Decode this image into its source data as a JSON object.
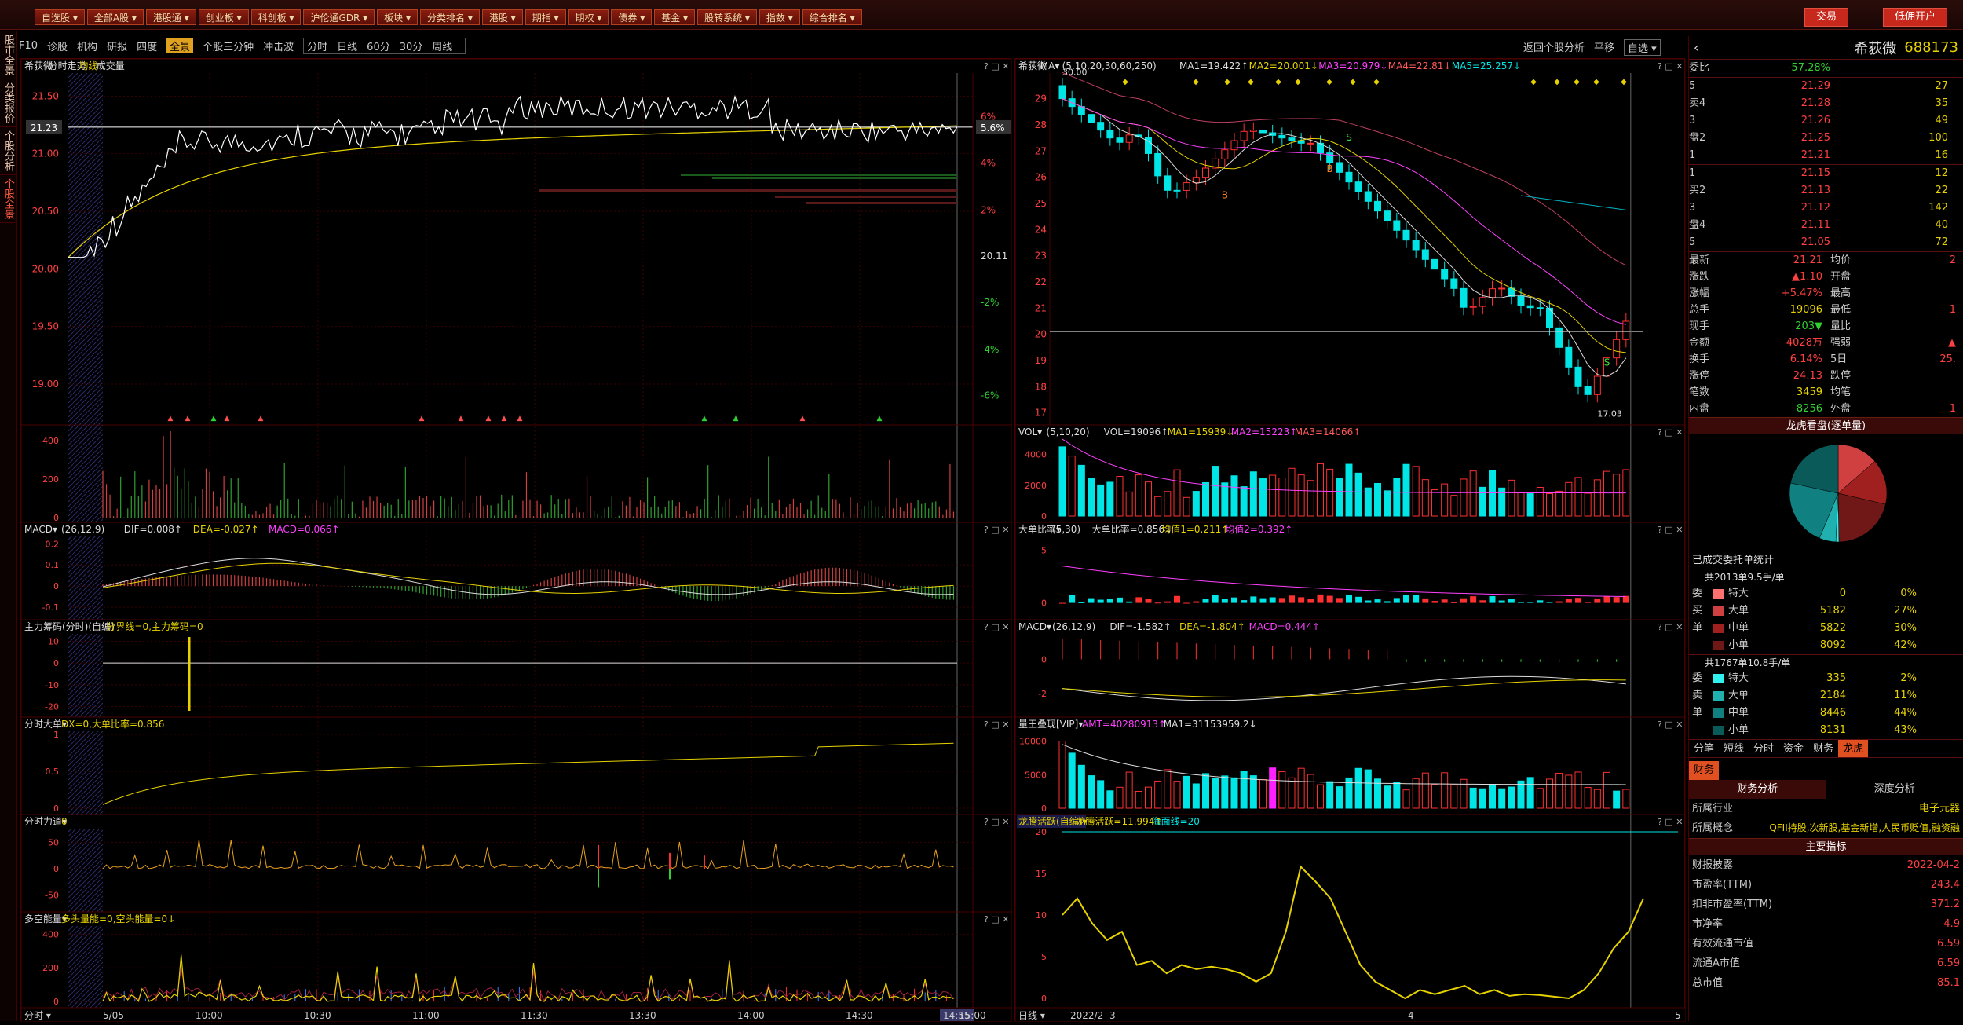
{
  "nav": {
    "items": [
      "自选股",
      "全部A股",
      "港股通",
      "创业板",
      "科创板",
      "沪伦通GDR",
      "板块",
      "分类排名",
      "港股",
      "期指",
      "期权",
      "债券",
      "基金",
      "股转系统",
      "指数",
      "综合排名"
    ],
    "right_buttons": [
      "交易",
      "低佣开户"
    ]
  },
  "left_rail": [
    "股市全景",
    "分类报价",
    "个股分析",
    "个股全景"
  ],
  "toolbar": {
    "items": [
      "F10",
      "诊股",
      "机构",
      "研报",
      "四度",
      "全景",
      "个股三分钟",
      "冲击波"
    ],
    "active": "全景",
    "period_tabs": [
      "分时",
      "日线",
      "60分",
      "30分",
      "周线"
    ],
    "right_items": [
      "返回个股分析",
      "平移",
      "自选"
    ]
  },
  "left_panels": {
    "main_title": {
      "name": "希荻微",
      "mode": "分时走势",
      "avg": "均线",
      "vol": "成交量"
    },
    "price_levels": [
      "21.50",
      "21.00",
      "20.50",
      "20.00",
      "19.50",
      "19.00"
    ],
    "current_price": "21.23",
    "pct_levels": [
      "6%",
      "4%",
      "2%",
      "20.11",
      "-2%",
      "-4%",
      "-6%"
    ],
    "current_pct": "5.6%",
    "vol_axis": [
      "400",
      "200",
      "0"
    ],
    "macd": {
      "label": "MACD",
      "params": "(26,12,9)",
      "dif": "DIF=0.008↑",
      "dea": "DEA=-0.027↑",
      "macd": "MACD=0.066↑",
      "axis": [
        "0.2",
        "0.1",
        "0",
        "-0.1"
      ]
    },
    "chip": {
      "label": "主力筹码(分时)(自编)",
      "text": "分界线=0,主力筹码=0",
      "axis": [
        "10",
        "0",
        "-10",
        "-20"
      ]
    },
    "big": {
      "label": "分时大单",
      "text": "DX=0,大单比率=0.856",
      "axis": [
        "1",
        "0.5",
        "0"
      ]
    },
    "force": {
      "label": "分时力道",
      "text": "0",
      "axis": [
        "50",
        "0",
        "-50"
      ]
    },
    "energy": {
      "label": "多空能量",
      "text": "多头量能=0,空头能量=0↓",
      "axis": [
        "400",
        "200",
        "0"
      ]
    },
    "time_axis": [
      "分时",
      "5/05",
      "10:00",
      "10:30",
      "11:00",
      "11:30",
      "13:30",
      "14:00",
      "14:30",
      "14:55",
      "15:00"
    ]
  },
  "mid_panels": {
    "kline": {
      "name": "希荻微",
      "ma": "MA",
      "params": "(5,10,20,30,60,250)",
      "ma1": "MA1=19.422↑",
      "ma2": "MA2=20.001↓",
      "ma3": "MA3=20.979↓",
      "ma4": "MA4=22.81↓",
      "ma5": "MA5=25.257↓",
      "axis": [
        "29",
        "28",
        "27",
        "26",
        "25",
        "24",
        "23",
        "22",
        "21",
        "20",
        "19",
        "18",
        "17"
      ],
      "high": "30.00",
      "low": "17.03",
      "signals": [
        "B",
        "B",
        "S",
        "S"
      ]
    },
    "vol": {
      "label": "VOL",
      "params": "(5,10,20)",
      "v": "VOL=19096↑",
      "ma1": "MA1=15939↓",
      "ma2": "MA2=15223↑",
      "ma3": "MA3=14066↑",
      "axis": [
        "4000",
        "2000",
        "0"
      ]
    },
    "big": {
      "label": "大单比率",
      "params": "(5,30)",
      "v": "大单比率=0.856↓",
      "a1": "均值1=0.211↑",
      "a2": "均值2=0.392↑",
      "axis": [
        "5",
        "0"
      ]
    },
    "macd": {
      "label": "MACD",
      "params": "(26,12,9)",
      "dif": "DIF=-1.582↑",
      "dea": "DEA=-1.804↑",
      "macd": "MACD=0.444↑",
      "axis": [
        "0",
        "-2"
      ]
    },
    "energy": {
      "label": "量王叠现[VIP]",
      "amt": "AMT=40280913↑",
      "ma1": "MA1=31153959.2↓",
      "axis": [
        "10000",
        "5000",
        "0"
      ]
    },
    "dragon": {
      "label": "龙腾活跃(自编)",
      "v": "龙腾活跃=11.994↑",
      "sea": "海面线=20",
      "axis": [
        "20",
        "15",
        "10",
        "5",
        "0"
      ]
    },
    "date_axis": [
      "日线",
      "2022/2",
      "3",
      "4",
      "5"
    ]
  },
  "quote": {
    "name": "希荻微",
    "code": "688173",
    "ratio_label": "委比",
    "ratio": "-57.28%",
    "asks": [
      {
        "k": "5",
        "p": "21.29",
        "v": "27"
      },
      {
        "k": "卖4",
        "p": "21.28",
        "v": "35"
      },
      {
        "k": "3",
        "p": "21.26",
        "v": "49"
      },
      {
        "k": "盘2",
        "p": "21.25",
        "v": "100"
      },
      {
        "k": "1",
        "p": "21.21",
        "v": "16"
      }
    ],
    "bids": [
      {
        "k": "1",
        "p": "21.15",
        "v": "12"
      },
      {
        "k": "买2",
        "p": "21.13",
        "v": "22"
      },
      {
        "k": "3",
        "p": "21.12",
        "v": "142"
      },
      {
        "k": "盘4",
        "p": "21.11",
        "v": "40"
      },
      {
        "k": "5",
        "p": "21.05",
        "v": "72"
      }
    ],
    "stats": [
      [
        "最新",
        "21.21",
        "均价",
        "2"
      ],
      [
        "涨跌",
        "▲1.10",
        "开盘",
        ""
      ],
      [
        "涨幅",
        "+5.47%",
        "最高",
        ""
      ],
      [
        "总手",
        "19096",
        "最低",
        "1"
      ],
      [
        "现手",
        "203▼",
        "量比",
        ""
      ],
      [
        "金额",
        "4028万",
        "强弱",
        "▲"
      ],
      [
        "换手",
        "6.14%",
        "5日",
        "25."
      ],
      [
        "涨停",
        "24.13",
        "跌停",
        ""
      ],
      [
        "笔数",
        "3459",
        "均笔",
        ""
      ],
      [
        "内盘",
        "8256",
        "外盘",
        "1"
      ]
    ]
  },
  "dragon_section": {
    "title": "龙虎看盘(逐单量)",
    "sub": "已成交委托单统计",
    "buy_total": "共2013单9.5手/单",
    "buy": [
      {
        "s": "委",
        "n": "特大",
        "q": "0",
        "pc": "0%",
        "c": "#ff7070"
      },
      {
        "s": "买",
        "n": "大单",
        "q": "5182",
        "pc": "27%",
        "c": "#d04040"
      },
      {
        "s": "单",
        "n": "中单",
        "q": "5822",
        "pc": "30%",
        "c": "#a02020"
      },
      {
        "s": "",
        "n": "小单",
        "q": "8092",
        "pc": "42%",
        "c": "#701818"
      }
    ],
    "sell_total": "共1767单10.8手/单",
    "sell": [
      {
        "s": "委",
        "n": "特大",
        "q": "335",
        "pc": "2%",
        "c": "#30f0f0"
      },
      {
        "s": "卖",
        "n": "大单",
        "q": "2184",
        "pc": "11%",
        "c": "#20b0b0"
      },
      {
        "s": "单",
        "n": "中单",
        "q": "8446",
        "pc": "44%",
        "c": "#108080"
      },
      {
        "s": "",
        "n": "小单",
        "q": "8131",
        "pc": "43%",
        "c": "#0a5a5a"
      }
    ],
    "tabs": [
      "分笔",
      "短线",
      "分时",
      "资金",
      "财务",
      "龙虎"
    ],
    "active_tab": "龙虎"
  },
  "finance": {
    "tab": "财务",
    "sub_tabs": [
      "财务分析",
      "深度分析"
    ],
    "industry_label": "所属行业",
    "industry": "电子元器",
    "concept_label": "所属概念",
    "concept": "QFII持股,次新股,基金新增,人民币贬值,融资融",
    "key_title": "主要指标",
    "rows": [
      [
        "财报披露",
        "2022-04-2"
      ],
      [
        "市盈率(TTM)",
        "243.4"
      ],
      [
        "扣非市盈率(TTM)",
        "371.2"
      ],
      [
        "市净率",
        "4.9"
      ],
      [
        "有效流通市值",
        "6.59"
      ],
      [
        "流通A市值",
        "6.59"
      ],
      [
        "总市值",
        "85.1"
      ]
    ]
  }
}
